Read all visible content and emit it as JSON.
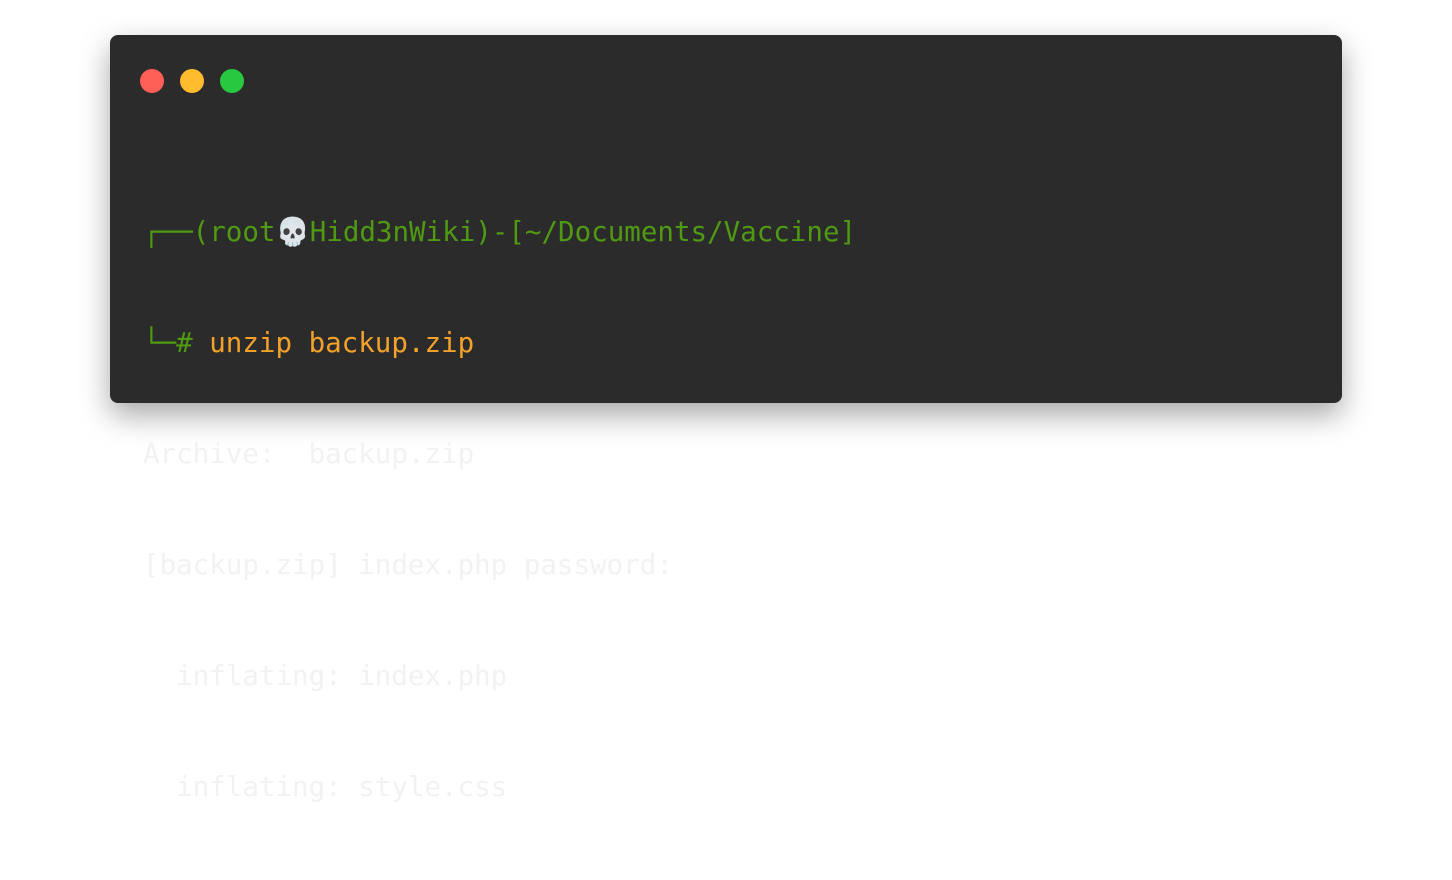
{
  "window": {
    "controls": [
      {
        "name": "close",
        "color": "#fe5f57"
      },
      {
        "name": "minimize",
        "color": "#febc2e"
      },
      {
        "name": "maximize",
        "color": "#28c840"
      }
    ]
  },
  "colors": {
    "background": "#2b2b2b",
    "prompt": "#4f9a12",
    "command": "#f2a12a",
    "output": "#f2f2f2"
  },
  "terminal": {
    "prompt_top": "┌──(root",
    "skull": "💀",
    "prompt_host": "Hidd3nWiki)-[~/Documents/Vaccine]",
    "prompt_bottom": "└─# ",
    "command": "unzip backup.zip",
    "output": [
      "Archive:  backup.zip",
      "[backup.zip] index.php password:",
      "  inflating: index.php",
      "  inflating: style.css"
    ]
  }
}
